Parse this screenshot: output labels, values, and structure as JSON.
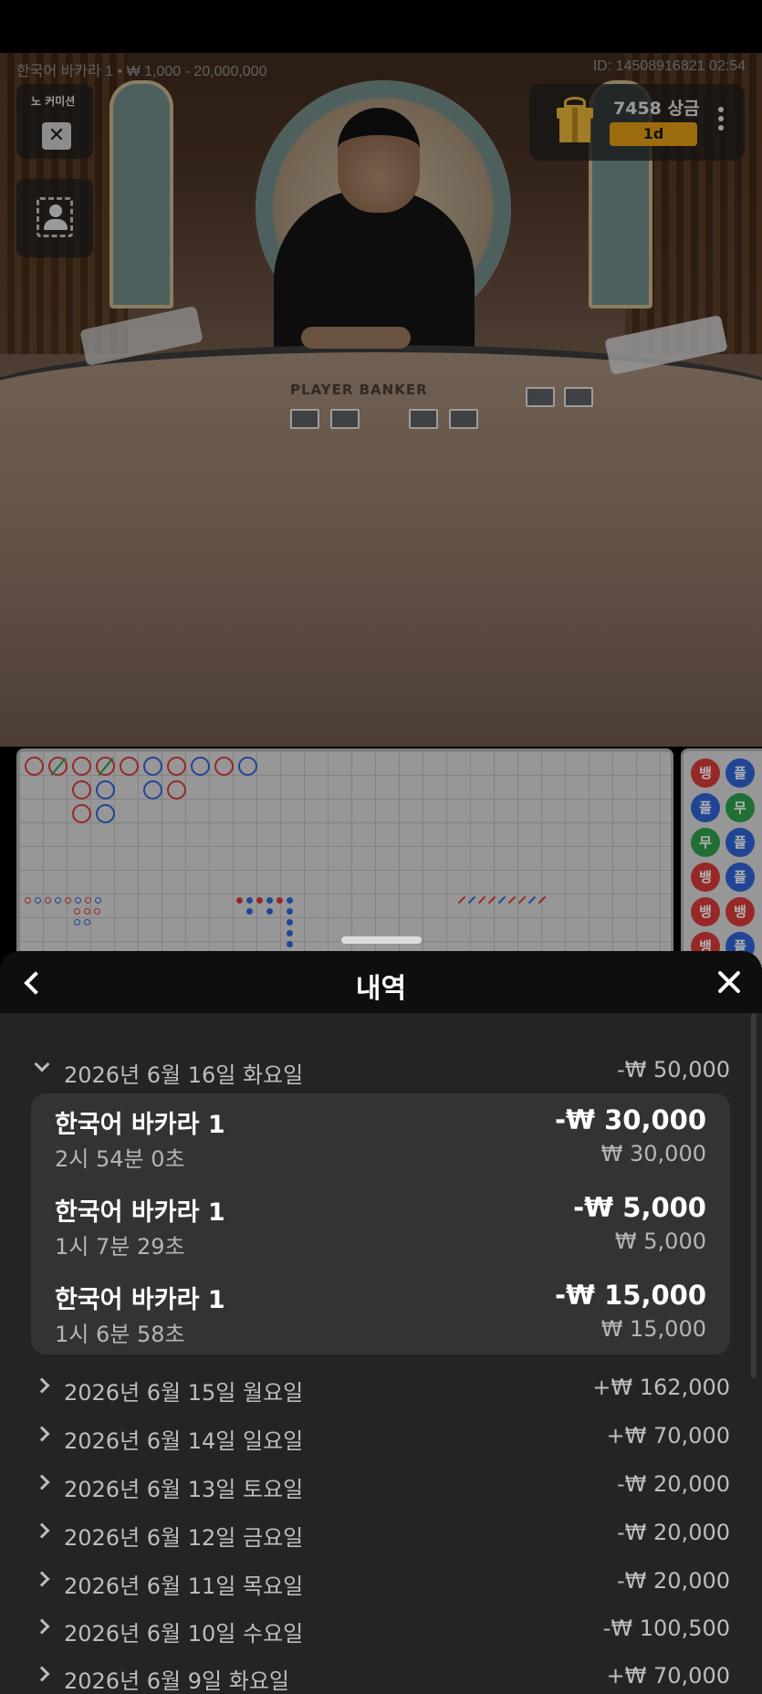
{
  "video": {
    "table_info": "한국어 바카라 1 • ₩ 1,000 - 20,000,000",
    "game_id": "ID: 14508916821 02:54",
    "table_label": "PLAYER  BANKER",
    "no_commission_label": "노 커미션",
    "close_symbol": "✕",
    "prize": {
      "text": "7458 상금",
      "tag": "1d"
    }
  },
  "roadmap": {
    "bead_colors": {
      "banker": "#d83a3a",
      "player": "#2f64d4",
      "tie": "#2fa04b"
    },
    "side_chips": [
      [
        "뱅",
        "플"
      ],
      [
        "플",
        "무"
      ],
      [
        "무",
        "플"
      ],
      [
        "뱅",
        "플"
      ],
      [
        "뱅",
        "뱅"
      ],
      [
        "뱅",
        "플"
      ]
    ]
  },
  "history": {
    "title": "내역",
    "expanded_day": {
      "date": "2026년 6월 16일 화요일",
      "amount": "-₩ 50,000"
    },
    "games": [
      {
        "name": "한국어 바카라 1",
        "duration": "2시 54분 0초",
        "result": "-₩ 30,000",
        "bet": "₩ 30,000"
      },
      {
        "name": "한국어 바카라 1",
        "duration": "1시 7분 29초",
        "result": "-₩ 5,000",
        "bet": "₩ 5,000"
      },
      {
        "name": "한국어 바카라 1",
        "duration": "1시 6분 58초",
        "result": "-₩ 15,000",
        "bet": "₩ 15,000"
      }
    ],
    "days": [
      {
        "date": "2026년 6월 15일 월요일",
        "amount": "+₩ 162,000"
      },
      {
        "date": "2026년 6월 14일 일요일",
        "amount": "+₩ 70,000"
      },
      {
        "date": "2026년 6월 13일 토요일",
        "amount": "-₩ 20,000"
      },
      {
        "date": "2026년 6월 12일 금요일",
        "amount": "-₩ 20,000"
      },
      {
        "date": "2026년 6월 11일 목요일",
        "amount": "-₩ 20,000"
      },
      {
        "date": "2026년 6월 10일 수요일",
        "amount": "-₩ 100,500"
      },
      {
        "date": "2026년 6월 9일 화요일",
        "amount": "+₩ 70,000"
      }
    ]
  }
}
